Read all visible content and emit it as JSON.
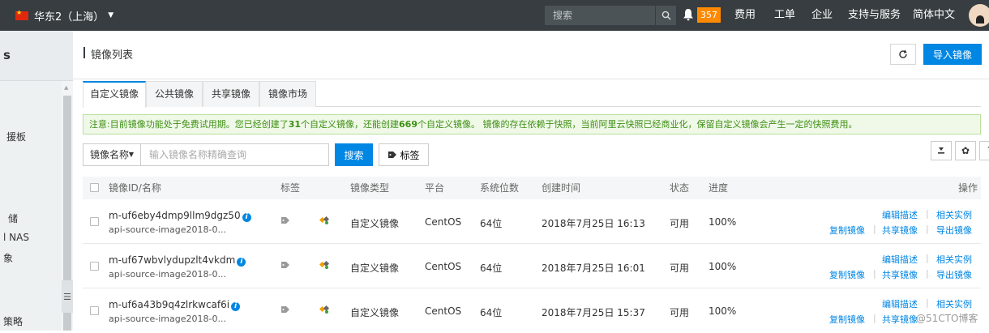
{
  "topbar": {
    "region": "华东2（上海）",
    "search_placeholder": "搜索",
    "notification_count": "357",
    "nav": [
      "费用",
      "工单",
      "企业",
      "支持与服务",
      "简体中文"
    ]
  },
  "sidebar": {
    "header_text": "s",
    "items": [
      "援板",
      "储",
      "l NAS",
      "象",
      "策略"
    ]
  },
  "page": {
    "title": "镜像列表",
    "import_label": "导入镜像"
  },
  "tabs": [
    "自定义镜像",
    "公共镜像",
    "共享镜像",
    "镜像市场"
  ],
  "notice": {
    "part1": "注意:目前镜像功能处于免费试用期。您已经创建了",
    "created": "31",
    "part2": "个自定义镜像，还能创建",
    "remaining": "669",
    "part3": "个自定义镜像。 镜像的存在依赖于快照，当前阿里云快照已经商业化，保留自定义镜像会产生一定的快照费用。"
  },
  "filter": {
    "field": "镜像名称",
    "placeholder": "输入镜像名称精确查询",
    "search_label": "搜索",
    "tag_label": "标签"
  },
  "table": {
    "headers": {
      "id_name": "镜像ID/名称",
      "tags": "标签",
      "type": "镜像类型",
      "platform": "平台",
      "bits": "系统位数",
      "created": "创建时间",
      "status": "状态",
      "progress": "进度",
      "actions": "操作"
    },
    "rows": [
      {
        "id": "m-uf6eby4dmp9llm9dgz50",
        "name": "api-source-image2018-0...",
        "type": "自定义镜像",
        "platform": "CentOS",
        "bits": "64位",
        "created": "2018年7月25日 16:13",
        "status": "可用",
        "progress": "100%"
      },
      {
        "id": "m-uf67wbvlydupzlt4vkdm",
        "name": "api-source-image2018-0...",
        "type": "自定义镜像",
        "platform": "CentOS",
        "bits": "64位",
        "created": "2018年7月25日 16:01",
        "status": "可用",
        "progress": "100%"
      },
      {
        "id": "m-uf6a43b9q4zlrkwcaf6i",
        "name": "api-source-image2018-0...",
        "type": "自定义镜像",
        "platform": "CentOS",
        "bits": "64位",
        "created": "2018年7月25日 15:37",
        "status": "可用",
        "progress": "100%"
      }
    ],
    "actions": {
      "edit_desc": "编辑描述",
      "related": "相关实例",
      "copy": "复制镜像",
      "share": "共享镜像",
      "export": "导出镜像"
    }
  },
  "watermark": "@51CTO博客",
  "colors": {
    "topbar": "#373d41",
    "primary": "#0086e3",
    "badge": "#ff8a00",
    "notice_text": "#3f8f15"
  }
}
